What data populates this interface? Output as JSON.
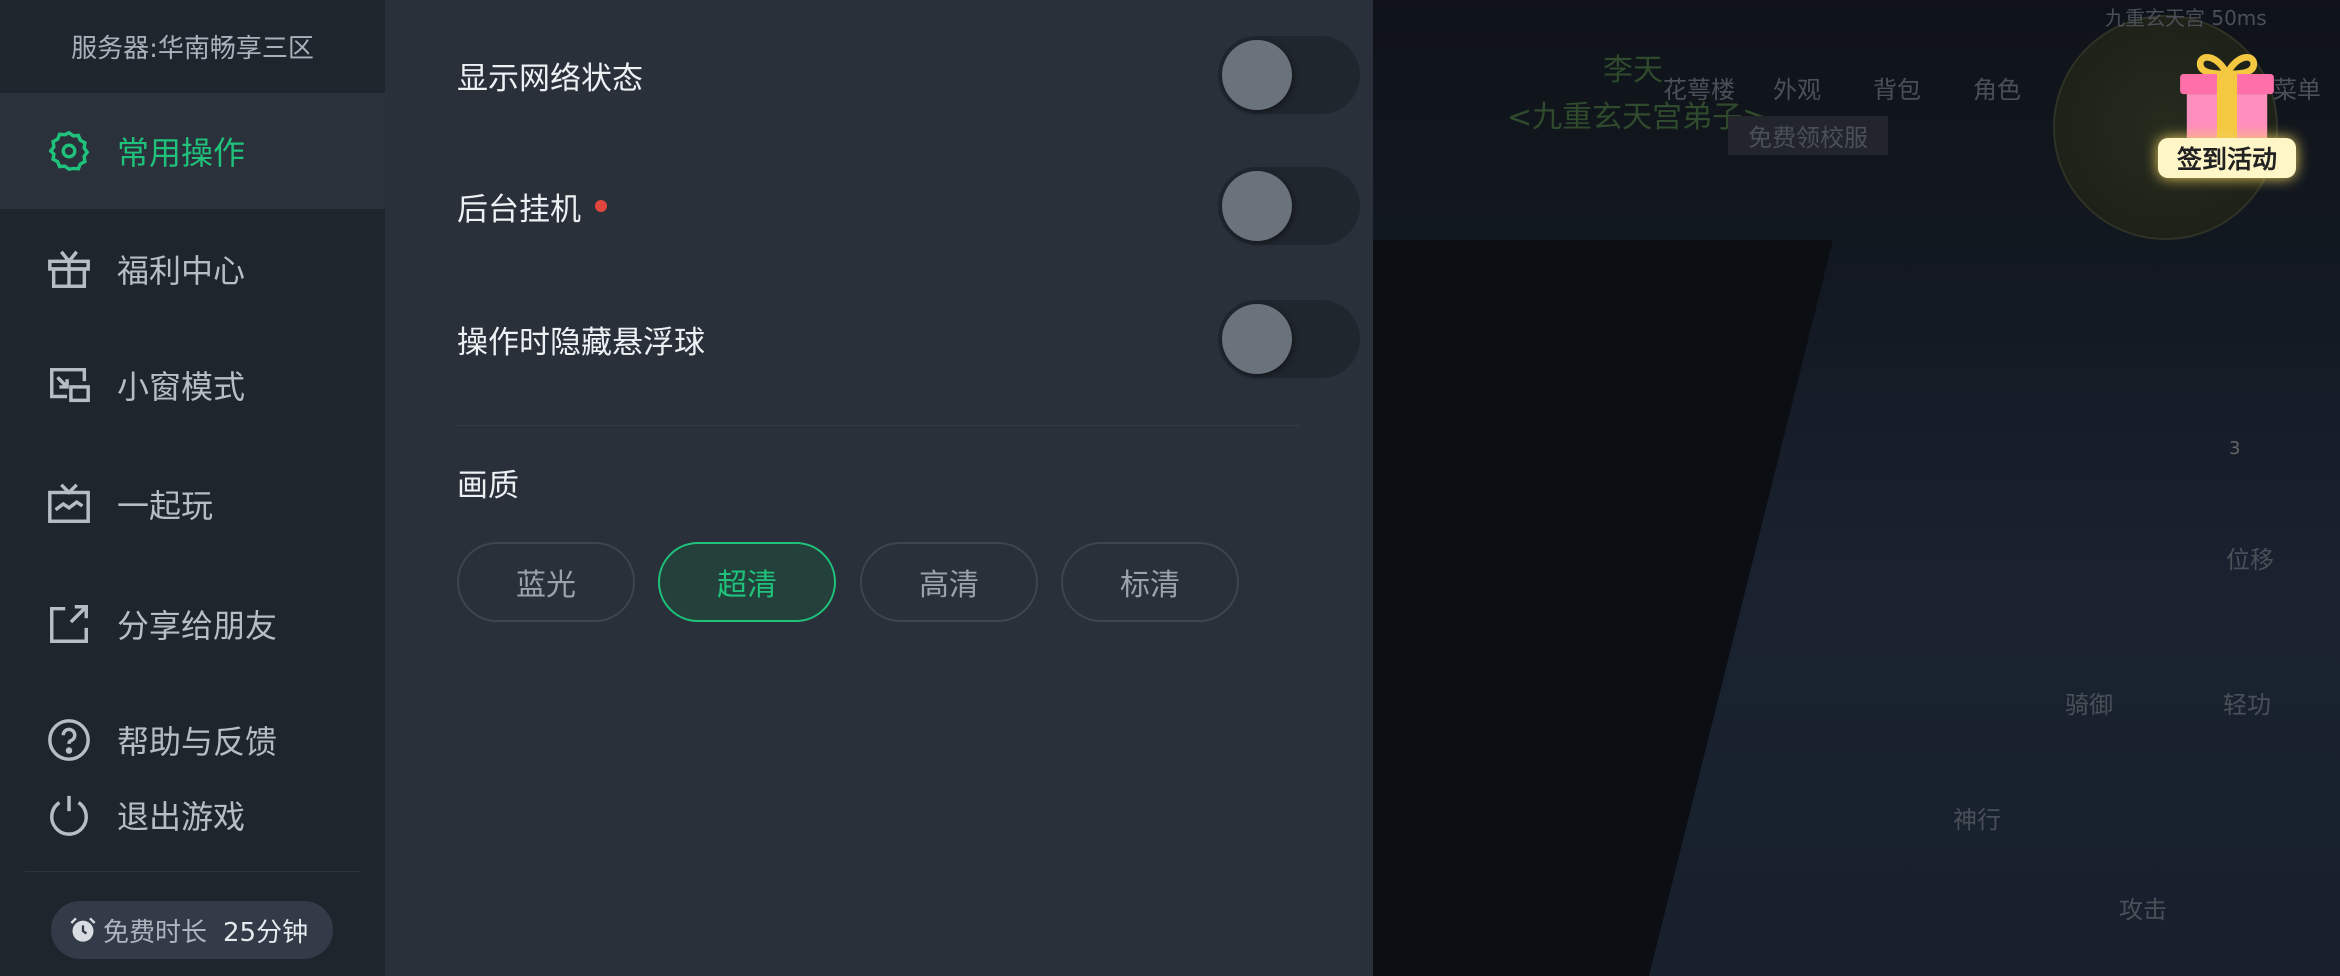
{
  "sidebar": {
    "server": "服务器:华南畅享三区",
    "items": [
      {
        "label": "常用操作",
        "icon": "gear-icon",
        "active": true
      },
      {
        "label": "福利中心",
        "icon": "gift-icon"
      },
      {
        "label": "小窗模式",
        "icon": "small-window-icon"
      },
      {
        "label": "一起玩",
        "icon": "tv-icon"
      },
      {
        "label": "分享给朋友",
        "icon": "share-icon"
      },
      {
        "label": "帮助与反馈",
        "icon": "help-icon"
      },
      {
        "label": "退出游戏",
        "icon": "power-icon"
      }
    ],
    "free_time": {
      "label": "免费时长",
      "value": "25分钟",
      "icon": "alarm-clock-icon"
    }
  },
  "settings": {
    "toggles": [
      {
        "label": "显示网络状态",
        "on": false
      },
      {
        "label": "后台挂机",
        "on": false,
        "badge_dot": true
      },
      {
        "label": "操作时隐藏悬浮球",
        "on": false
      }
    ],
    "quality": {
      "label": "画质",
      "options": [
        "蓝光",
        "超清",
        "高清",
        "标清"
      ],
      "selected": "超清"
    }
  },
  "colors": {
    "accent": "#1fc17b",
    "badge": "#e0463b",
    "sidebar_bg": "#1f252d",
    "panel_bg": "#29303a"
  },
  "game": {
    "status": "九重玄天宫  50ms",
    "top_menu": [
      "花萼楼",
      "外观",
      "背包",
      "角色",
      "菜单"
    ],
    "player_name": "李天",
    "player_guild": "<九重玄天宫弟子>",
    "banner": "免费领校服",
    "signin": "签到活动",
    "skills": [
      "位移",
      "骑御",
      "轻功",
      "神行",
      "攻击"
    ],
    "skill_count": "3"
  }
}
